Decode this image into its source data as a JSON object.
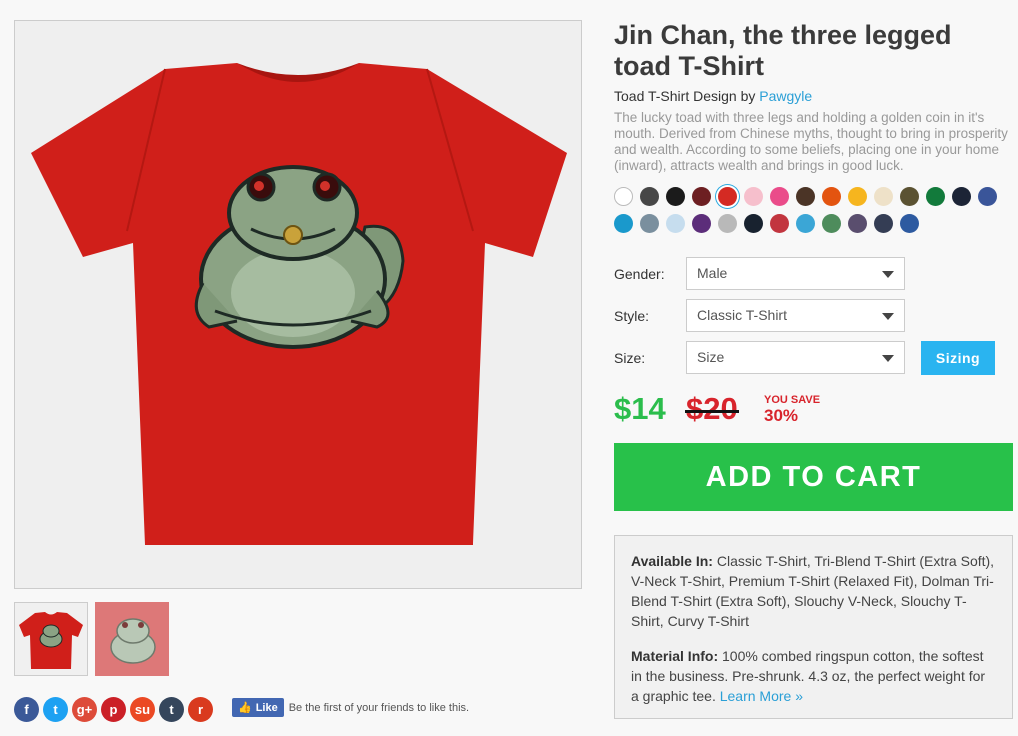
{
  "product": {
    "title": "Jin Chan, the three legged toad T-Shirt",
    "by_prefix": "Toad T-Shirt Design by",
    "artist": "Pawgyle",
    "description": "The lucky toad with three legs and holding a golden coin in it's mouth. Derived from Chinese myths, thought to bring in prosperity and wealth. According to some beliefs, placing one in your home (inward), attracts wealth and brings in good luck."
  },
  "swatches": [
    {
      "color": "#ffffff"
    },
    {
      "color": "#474747"
    },
    {
      "color": "#1b1b1b"
    },
    {
      "color": "#6d1f22"
    },
    {
      "color": "#d42a23",
      "selected": true
    },
    {
      "color": "#f6bfcc"
    },
    {
      "color": "#ea4c8a"
    },
    {
      "color": "#4b3426"
    },
    {
      "color": "#e35410"
    },
    {
      "color": "#f6b51e"
    },
    {
      "color": "#eee1c8"
    },
    {
      "color": "#5b5232"
    },
    {
      "color": "#127a3b"
    },
    {
      "color": "#1c2436"
    },
    {
      "color": "#3a5599"
    },
    {
      "color": "#1a99cc"
    },
    {
      "color": "#7a8f9e"
    },
    {
      "color": "#c6ddee"
    },
    {
      "color": "#5c2d7a"
    },
    {
      "color": "#b9b9b9"
    },
    {
      "color": "#18222f"
    },
    {
      "color": "#c2353f"
    },
    {
      "color": "#3ba6d6"
    },
    {
      "color": "#4e8c5c"
    },
    {
      "color": "#5a4e6e"
    },
    {
      "color": "#343d54"
    },
    {
      "color": "#2d5aa0"
    }
  ],
  "options": {
    "gender_label": "Gender:",
    "gender_value": "Male",
    "style_label": "Style:",
    "style_value": "Classic T-Shirt",
    "size_label": "Size:",
    "size_value": "Size",
    "sizing_button": "Sizing"
  },
  "pricing": {
    "price": "$14",
    "old_price": "$20",
    "you_save": "YOU SAVE",
    "save_percent": "30%"
  },
  "cart_button": "ADD TO CART",
  "info": {
    "available_label": "Available In:",
    "available_text": "Classic T-Shirt, Tri-Blend T-Shirt (Extra Soft), V-Neck T-Shirt, Premium T-Shirt (Relaxed Fit), Dolman Tri-Blend T-Shirt (Extra Soft), Slouchy V-Neck, Slouchy T-Shirt, Curvy T-Shirt",
    "material_label": "Material Info:",
    "material_text": "100% combed ringspun cotton, the softest in the business. Pre-shrunk. 4.3 oz, the perfect weight for a graphic tee.",
    "learn_more": "Learn More »"
  },
  "social": {
    "icons": [
      {
        "name": "facebook-icon",
        "glyph": "f",
        "color": "#3b5998"
      },
      {
        "name": "twitter-icon",
        "glyph": "t",
        "color": "#1da1f2"
      },
      {
        "name": "google-plus-icon",
        "glyph": "g+",
        "color": "#dd4b39"
      },
      {
        "name": "pinterest-icon",
        "glyph": "p",
        "color": "#cb2027"
      },
      {
        "name": "stumbleupon-icon",
        "glyph": "su",
        "color": "#eb4924"
      },
      {
        "name": "tumblr-icon",
        "glyph": "t",
        "color": "#35465c"
      },
      {
        "name": "reddit-icon",
        "glyph": "r",
        "color": "#d93a1e"
      }
    ],
    "like_button": "Like",
    "like_text": "Be the first of your friends to like this."
  },
  "shirt_color": "#d01f1a"
}
